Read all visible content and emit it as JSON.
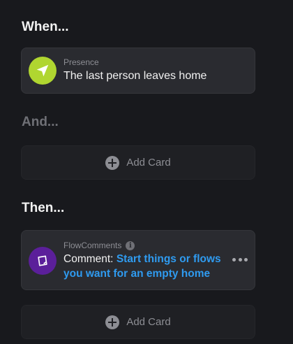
{
  "sections": {
    "when": "When...",
    "and": "And...",
    "then": "Then..."
  },
  "trigger_card": {
    "source": "Presence",
    "title": "The last person leaves home",
    "icon": "navigation-arrow-icon",
    "icon_color": "#b0d630"
  },
  "add_card_label": "Add Card",
  "action_card": {
    "source": "FlowComments",
    "prefix": "Comment:",
    "text": "Start things or flows you want for an empty home",
    "icon": "note-icon",
    "icon_color": "#5b1f9a"
  },
  "colors": {
    "background": "#18191d",
    "card": "#2a2b30",
    "link": "#2f9bf0"
  }
}
